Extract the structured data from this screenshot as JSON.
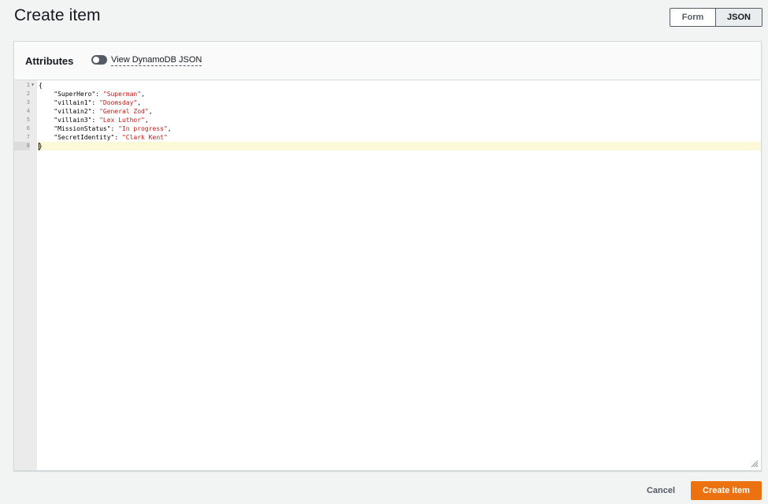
{
  "page": {
    "title": "Create item"
  },
  "mode_toggle": {
    "form_label": "Form",
    "json_label": "JSON",
    "selected": "JSON"
  },
  "attributes_panel": {
    "title": "Attributes",
    "view_dynamodb_json_label": "View DynamoDB JSON",
    "view_dynamodb_json_enabled": false
  },
  "editor": {
    "active_line": 8,
    "lines": [
      {
        "num": "1",
        "fold": true,
        "parts": [
          {
            "t": "punc",
            "v": "{"
          }
        ]
      },
      {
        "num": "2",
        "fold": false,
        "parts": [
          {
            "t": "key",
            "v": "    \"SuperHero\": "
          },
          {
            "t": "str",
            "v": "\"Superman\""
          },
          {
            "t": "punc",
            "v": ","
          }
        ]
      },
      {
        "num": "3",
        "fold": false,
        "parts": [
          {
            "t": "key",
            "v": "    \"villain1\": "
          },
          {
            "t": "str",
            "v": "\"Doomsday\""
          },
          {
            "t": "punc",
            "v": ","
          }
        ]
      },
      {
        "num": "4",
        "fold": false,
        "parts": [
          {
            "t": "key",
            "v": "    \"villain2\": "
          },
          {
            "t": "str",
            "v": "\"General Zod\""
          },
          {
            "t": "punc",
            "v": ","
          }
        ]
      },
      {
        "num": "5",
        "fold": false,
        "parts": [
          {
            "t": "key",
            "v": "    \"villain3\": "
          },
          {
            "t": "str",
            "v": "\"Lex Luthor\""
          },
          {
            "t": "punc",
            "v": ","
          }
        ]
      },
      {
        "num": "6",
        "fold": false,
        "parts": [
          {
            "t": "key",
            "v": "    \"MissionStatus\": "
          },
          {
            "t": "str",
            "v": "\"In progress\""
          },
          {
            "t": "punc",
            "v": ","
          }
        ]
      },
      {
        "num": "7",
        "fold": false,
        "parts": [
          {
            "t": "key",
            "v": "    \"SecretIdentity\": "
          },
          {
            "t": "str",
            "v": "\"Clark Kent\""
          }
        ]
      },
      {
        "num": "8",
        "fold": false,
        "parts": [
          {
            "t": "punc",
            "v": "}"
          }
        ]
      }
    ],
    "fold_icon": "fold-caret-icon",
    "resize_icon": "resize-grip-icon"
  },
  "footer": {
    "cancel_label": "Cancel",
    "create_label": "Create item"
  },
  "colors": {
    "primary_button": "#ec7211",
    "string_literal": "#c41a16",
    "active_line": "#fcf9d8"
  }
}
